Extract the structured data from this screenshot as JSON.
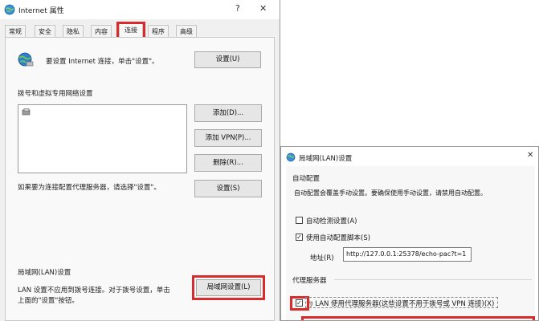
{
  "ie_window": {
    "title": "Internet 属性",
    "help_glyph": "?",
    "close_glyph": "✕",
    "tabs": [
      {
        "label": "常规"
      },
      {
        "label": "安全"
      },
      {
        "label": "隐私"
      },
      {
        "label": "内容"
      },
      {
        "label": "连接"
      },
      {
        "label": "程序"
      },
      {
        "label": "高级"
      }
    ],
    "active_tab": "连接",
    "setup_text": "要设置 Internet 连接，单击\"设置\"。",
    "setup_button": "设置(U)",
    "dialup_section_title": "拨号和虚拟专用网络设置",
    "add_button": "添加(D)...",
    "add_vpn_button": "添加 VPN(P)...",
    "remove_button": "删除(R)...",
    "proxy_hint": "如果要为连接配置代理服务器，请选择\"设置\"。",
    "settings_button": "设置(S)",
    "lan_section_title": "局域网(LAN)设置",
    "lan_desc_line1": "LAN 设置不应用到拨号连接。对于拨号设置，单击",
    "lan_desc_line2": "上面的\"设置\"按钮。",
    "lan_settings_button": "局域网设置(L)"
  },
  "lan_window": {
    "title": "局域网(LAN)设置",
    "close_glyph": "✕",
    "auto_config_title": "自动配置",
    "auto_config_desc": "自动配置会覆盖手动设置。要确保使用手动设置，请禁用自动配置。",
    "auto_detect_label": "自动检测设置(A)",
    "auto_detect_checked": false,
    "use_script_label": "使用自动配置脚本(S)",
    "use_script_checked": true,
    "address_label": "地址(R)",
    "address_value": "http://127.0.0.1:25378/echo-pac?t=1",
    "proxy_section_title": "代理服务器",
    "proxy_checkbox_label": "为 LAN 使用代理服务器(这些设置不用于拨号或 VPN 连接)(X)",
    "proxy_checked": true
  },
  "colors": {
    "highlight_red": "#d92b2b",
    "window_bg": "#f0f0f0",
    "button_bg": "#e6e6e6"
  }
}
